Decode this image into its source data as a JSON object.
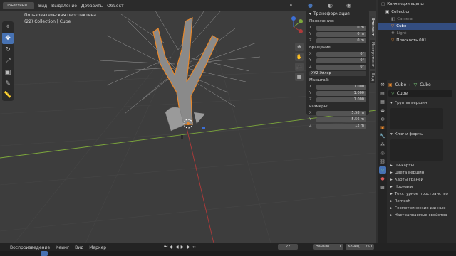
{
  "header": {
    "mode": "Объектный ...",
    "menus": [
      "Вид",
      "Выделение",
      "Добавить",
      "Объект"
    ],
    "view_name": "Пользовательская перспектива",
    "collection_label": "(22) Collection | Cube"
  },
  "npanel": {
    "title": "Трансформация",
    "location_label": "Положение:",
    "location": [
      {
        "axis": "X",
        "value": "0 m"
      },
      {
        "axis": "Y",
        "value": "0 m"
      },
      {
        "axis": "Z",
        "value": "0 m"
      }
    ],
    "rotation_label": "Вращение:",
    "rotation": [
      {
        "axis": "X",
        "value": "0°"
      },
      {
        "axis": "Y",
        "value": "0°"
      },
      {
        "axis": "Z",
        "value": "0°"
      }
    ],
    "rotation_mode": "XYZ Эйлер",
    "scale_label": "Масштаб:",
    "scale": [
      {
        "axis": "X",
        "value": "1.000"
      },
      {
        "axis": "Y",
        "value": "1.000"
      },
      {
        "axis": "Z",
        "value": "1.000"
      }
    ],
    "dimensions_label": "Размеры:",
    "dimensions": [
      {
        "axis": "X",
        "value": "5.58 m"
      },
      {
        "axis": "Y",
        "value": "5.56 m"
      },
      {
        "axis": "Z",
        "value": "12 m"
      }
    ],
    "tabs": [
      "Элемент",
      "Инструмент",
      "Вид"
    ]
  },
  "outliner": {
    "root": "Коллекция сцены",
    "items": [
      "Collection",
      "Camera",
      "Cube",
      "Light",
      "Плоскость.001"
    ]
  },
  "properties": {
    "object_name": "Cube",
    "data_name": "Cube",
    "mesh_name": "Cube",
    "sections": [
      "Группы вершин",
      "Ключи формы",
      "UV-карты",
      "Цвета вершин",
      "Карты граней",
      "Нормали",
      "Текстурное пространство",
      "Remesh",
      "Геометрические данные",
      "Настраиваемые свойства"
    ]
  },
  "timeline": {
    "playback": "Воспроизведение",
    "keying": "Кеинг",
    "view": "Вид",
    "marker": "Маркер",
    "current_frame": "22",
    "start_label": "Начало",
    "start": "1",
    "end_label": "Конец",
    "end": "250"
  },
  "colors": {
    "accent": "#4772b3",
    "selected_orange": "#e8882c",
    "x_axis": "#b03a3a",
    "y_axis": "#7da83c"
  }
}
